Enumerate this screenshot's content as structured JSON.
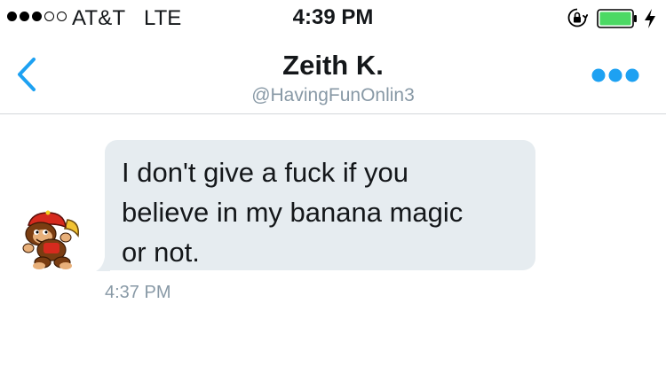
{
  "status_bar": {
    "signal_filled": 3,
    "signal_total": 5,
    "carrier": "AT&T",
    "network": "LTE",
    "time": "4:39 PM",
    "battery_color": "#4cd964"
  },
  "nav": {
    "title": "Zeith K.",
    "handle": "@HavingFunOnlin3",
    "back_icon": "chevron-left-icon",
    "more_icon": "more-horizontal-icon",
    "accent_color": "#1da1f2"
  },
  "message": {
    "lines": [
      "I don't give a fuck if you",
      "believe in my banana magic",
      "or not."
    ],
    "timestamp": "4:37 PM",
    "bubble_color": "#e6ecf0"
  }
}
